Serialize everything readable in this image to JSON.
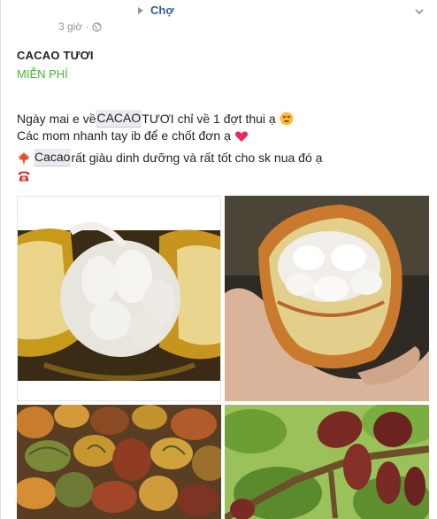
{
  "header": {
    "timestamp": "3 giờ ·",
    "breadcrumb_label": "Chợ",
    "icons": {
      "privacy": "globe-icon",
      "menu": "chevron-down-icon",
      "separator": "triangle-right-icon"
    }
  },
  "listing": {
    "title": "CACAO TƯƠI",
    "price": "MIỄN PHÍ"
  },
  "body": {
    "line1_prefix": "Ngày mai e về ",
    "line1_tag": "CACAO",
    "line1_suffix": " TƯƠI chỉ về 1 đợt thui ạ",
    "line2": "Các mom nhanh tay ib để e chốt đơn ạ",
    "line3_tag": "Cacao",
    "line3_suffix": " rất giàu dinh dưỡng và rất tốt cho sk nua đó ạ",
    "icons": [
      "heart-eyes-emoji-icon",
      "red-heart-icon",
      "maple-leaf-icon",
      "telephone-icon"
    ]
  },
  "photos": [
    "cacao-pod-open-photo",
    "cacao-pod-in-hand-photo",
    "cacao-pods-pile-photo",
    "cacao-pods-on-tree-photo"
  ],
  "colors": {
    "link": "#365899",
    "price": "#42b72a",
    "meta": "#90949c",
    "text": "#1d2129"
  }
}
